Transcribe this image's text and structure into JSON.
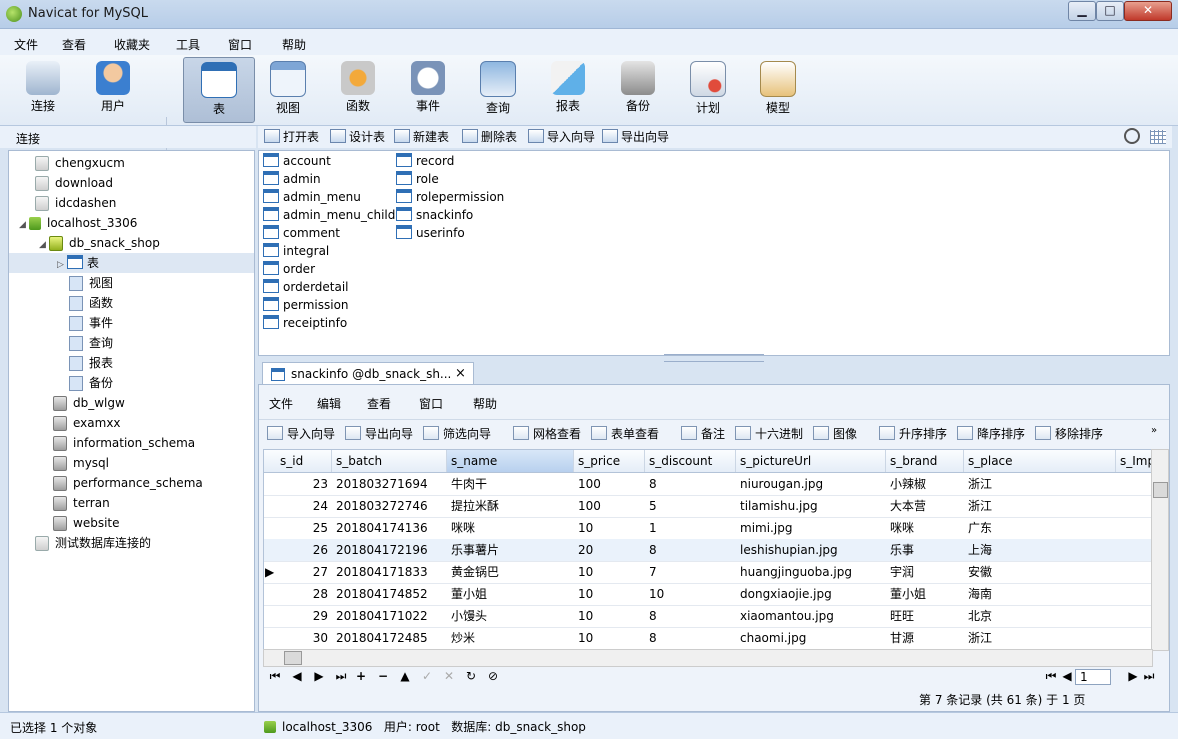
{
  "window": {
    "title": "Navicat for MySQL"
  },
  "menubar": [
    "文件",
    "查看",
    "收藏夹",
    "工具",
    "窗口",
    "帮助"
  ],
  "toolbar": [
    {
      "label": "连接",
      "icon": "connection-icon"
    },
    {
      "label": "用户",
      "icon": "user-icon"
    },
    {
      "label": "表",
      "icon": "table-icon",
      "active": true
    },
    {
      "label": "视图",
      "icon": "view-icon"
    },
    {
      "label": "函数",
      "icon": "function-icon"
    },
    {
      "label": "事件",
      "icon": "event-icon"
    },
    {
      "label": "查询",
      "icon": "query-icon"
    },
    {
      "label": "报表",
      "icon": "report-icon"
    },
    {
      "label": "备份",
      "icon": "backup-icon"
    },
    {
      "label": "计划",
      "icon": "schedule-icon"
    },
    {
      "label": "模型",
      "icon": "model-icon"
    }
  ],
  "left_header": "连接",
  "tree": [
    {
      "label": "chengxucm",
      "icon": "db"
    },
    {
      "label": "download",
      "icon": "db"
    },
    {
      "label": "idcdashen",
      "icon": "db"
    },
    {
      "label": "localhost_3306",
      "icon": "conn",
      "expanded": true
    },
    {
      "label": "db_snack_shop",
      "icon": "dbgreen",
      "expanded": true
    },
    {
      "label": "表",
      "icon": "small",
      "selected": true
    },
    {
      "label": "视图",
      "icon": "small"
    },
    {
      "label": "函数",
      "icon": "small"
    },
    {
      "label": "事件",
      "icon": "small"
    },
    {
      "label": "查询",
      "icon": "small"
    },
    {
      "label": "报表",
      "icon": "small"
    },
    {
      "label": "备份",
      "icon": "small"
    },
    {
      "label": "db_wlgw",
      "icon": "dbgray"
    },
    {
      "label": "examxx",
      "icon": "dbgray"
    },
    {
      "label": "information_schema",
      "icon": "dbgray"
    },
    {
      "label": "mysql",
      "icon": "dbgray"
    },
    {
      "label": "performance_schema",
      "icon": "dbgray"
    },
    {
      "label": "terran",
      "icon": "dbgray"
    },
    {
      "label": "website",
      "icon": "dbgray"
    },
    {
      "label": "测试数据库连接的",
      "icon": "db"
    }
  ],
  "object_toolbar": [
    "打开表",
    "设计表",
    "新建表",
    "删除表",
    "导入向导",
    "导出向导"
  ],
  "tables_col1": [
    "account",
    "admin",
    "admin_menu",
    "admin_menu_child",
    "comment",
    "integral",
    "order",
    "orderdetail",
    "permission",
    "receiptinfo"
  ],
  "tables_col2": [
    "record",
    "role",
    "rolepermission",
    "snackinfo",
    "userinfo"
  ],
  "tab": {
    "title": "snackinfo @db_snack_sh...",
    "close": "×"
  },
  "editor_menu": [
    "文件",
    "编辑",
    "查看",
    "窗口",
    "帮助"
  ],
  "editor_toolbar": [
    "导入向导",
    "导出向导",
    "筛选向导",
    "网格查看",
    "表单查看",
    "备注",
    "十六进制",
    "图像",
    "升序排序",
    "降序排序",
    "移除排序"
  ],
  "grid": {
    "columns": [
      "s_id",
      "s_batch",
      "s_name",
      "s_price",
      "s_discount",
      "s_pictureUrl",
      "s_brand",
      "s_place",
      "s_Imp"
    ],
    "rows": [
      [
        "23",
        "201803271694",
        "牛肉干",
        "100",
        "8",
        "niurougan.jpg",
        "小辣椒",
        "浙江"
      ],
      [
        "24",
        "201803272746",
        "提拉米酥",
        "100",
        "5",
        "tilamishu.jpg",
        "大本营",
        "浙江"
      ],
      [
        "25",
        "201804174136",
        "咪咪",
        "10",
        "1",
        "mimi.jpg",
        "咪咪",
        "广东"
      ],
      [
        "26",
        "201804172196",
        "乐事薯片",
        "20",
        "8",
        "leshishupian.jpg",
        "乐事",
        "上海"
      ],
      [
        "27",
        "201804171833",
        "黄金锅巴",
        "10",
        "7",
        "huangjinguoba.jpg",
        "宇润",
        "安徽"
      ],
      [
        "28",
        "201804174852",
        "董小姐",
        "10",
        "10",
        "dongxiaojie.jpg",
        "董小姐",
        "海南"
      ],
      [
        "29",
        "201804171022",
        "小馒头",
        "10",
        "8",
        "xiaomantou.jpg",
        "旺旺",
        "北京"
      ],
      [
        "30",
        "201804172485",
        "炒米",
        "10",
        "8",
        "chaomi.jpg",
        "甘源",
        "浙江"
      ]
    ]
  },
  "nav": {
    "page": "1",
    "record_info": "第 7 条记录 (共 61 条) 于 1 页"
  },
  "status": {
    "left": "已选择 1 个对象",
    "connection": "localhost_3306",
    "user": "用户: root",
    "database": "数据库: db_snack_shop"
  }
}
